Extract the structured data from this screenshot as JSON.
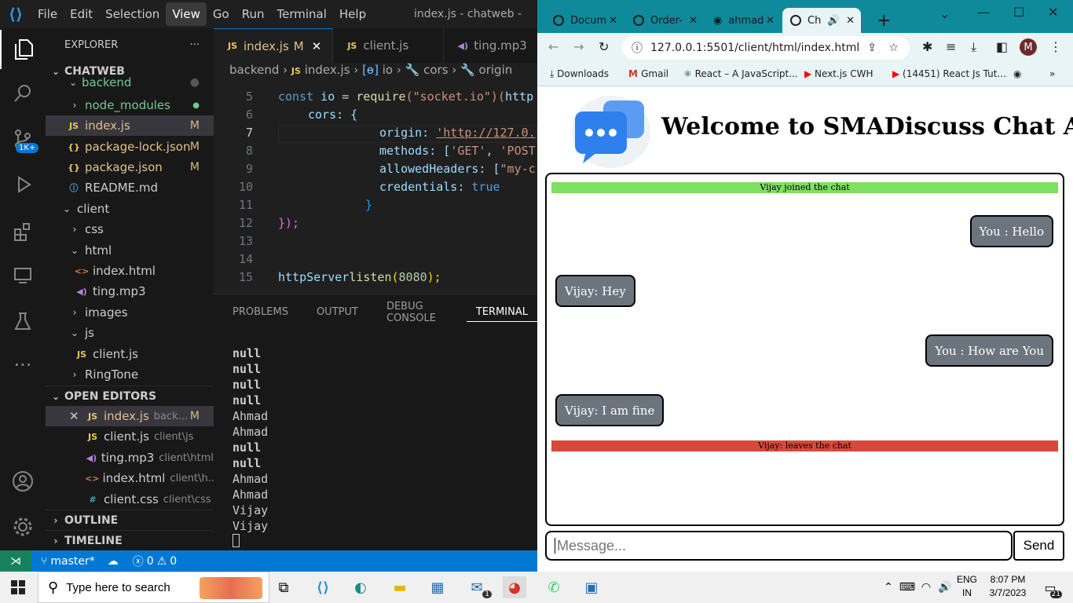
{
  "vscode": {
    "menu": [
      "File",
      "Edit",
      "Selection",
      "View",
      "Go",
      "Run",
      "Terminal",
      "Help"
    ],
    "window_title": "index.js - chatweb -",
    "activity_badge": "1K+",
    "explorer": {
      "header": "EXPLORER",
      "more": "···",
      "root": "CHATWEB",
      "items": [
        {
          "label": "backend",
          "icon": "chevron-down"
        },
        {
          "label": "node_modules",
          "icon": "chevron-right"
        },
        {
          "label": "index.js",
          "icon": "js",
          "mod": "M"
        },
        {
          "label": "package-lock.json",
          "icon": "json",
          "mod": "M"
        },
        {
          "label": "package.json",
          "icon": "json",
          "mod": "M"
        },
        {
          "label": "README.md",
          "icon": "info"
        },
        {
          "label": "client",
          "icon": "chevron-down"
        },
        {
          "label": "css",
          "icon": "chevron-right"
        },
        {
          "label": "html",
          "icon": "chevron-down"
        },
        {
          "label": "index.html",
          "icon": "html"
        },
        {
          "label": "ting.mp3",
          "icon": "audio"
        },
        {
          "label": "images",
          "icon": "chevron-right"
        },
        {
          "label": "js",
          "icon": "chevron-down"
        },
        {
          "label": "client.js",
          "icon": "js"
        },
        {
          "label": "RingTone",
          "icon": "chevron-right"
        }
      ],
      "open_editors_header": "OPEN EDITORS",
      "open_editors": [
        {
          "label": "index.js",
          "path": "back...",
          "mod": "M"
        },
        {
          "label": "client.js",
          "path": "client\\js"
        },
        {
          "label": "ting.mp3",
          "path": "client\\html"
        },
        {
          "label": "index.html",
          "path": "client\\h..."
        },
        {
          "label": "client.css",
          "path": "client\\css"
        }
      ],
      "outline": "OUTLINE",
      "timeline": "TIMELINE"
    },
    "tabs": [
      {
        "label": "index.js",
        "mod": "M",
        "active": true
      },
      {
        "label": "client.js"
      },
      {
        "label": "ting.mp3"
      }
    ],
    "breadcrumb": [
      "backend",
      "index.js",
      "io",
      "cors",
      "origin"
    ],
    "code_lines": [
      "5",
      "6",
      "7",
      "8",
      "9",
      "10",
      "11",
      "12",
      "13",
      "14",
      "15"
    ],
    "code": {
      "l5_a": "const",
      "l5_b": " io ",
      "l5_c": "= ",
      "l5_d": "require",
      "l5_e": "(\"socket.io\")(",
      "l5_f": "http",
      "l6": "cors: {",
      "l7_a": "origin: ",
      "l7_b": "'http://127.0.",
      "l8_a": "methods: [",
      "l8_b": "'GET'",
      ", ": ", ",
      "l8_c": "'POST",
      "l9_a": "allowedHeaders: [",
      "l9_b": "\"my-c",
      "l10_a": "credentials: ",
      "l10_b": "true",
      "l11": "}",
      "l12": "});",
      "l15_a": "httpServer",
      ".": ".",
      "l15_b": "listen",
      "l15_c": "(",
      "l15_d": "8080",
      "l15_e": ");"
    },
    "panel_tabs": [
      "PROBLEMS",
      "OUTPUT",
      "DEBUG CONSOLE",
      "TERMINAL"
    ],
    "terminal_lines": [
      "null",
      "null",
      "null",
      "null",
      "Ahmad",
      "Ahmad",
      "null",
      "null",
      "Ahmad",
      "Ahmad",
      "Vijay",
      "Vijay"
    ],
    "status": {
      "branch": "master*",
      "errors": "0",
      "warnings": "0"
    }
  },
  "browser": {
    "tabs": [
      "Docum",
      "Order-",
      "ahmad",
      "Ch"
    ],
    "new_tab": "+",
    "url": "127.0.0.1:5501/client/html/index.html",
    "profile": "M",
    "bookmarks": [
      "Downloads",
      "Gmail",
      "React – A JavaScript...",
      "Next.js CWH",
      "(14451) React Js Tut..."
    ],
    "page": {
      "title": "Welcome to SMADiscuss Chat App",
      "joined": "Vijay joined the chat",
      "messages": [
        {
          "text": "You : Hello",
          "side": "right"
        },
        {
          "text": "Vijay: Hey",
          "side": "left"
        },
        {
          "text": "You : How are You",
          "side": "right"
        },
        {
          "text": "Vijay: I am fine",
          "side": "left"
        }
      ],
      "left": "Vijay: leaves the chat",
      "input_placeholder": "Message...",
      "send_label": "Send",
      "joined_color": "#7ee062",
      "left_color": "#d9493b"
    }
  },
  "taskbar": {
    "search_placeholder": "Type here to search",
    "lang_1": "ENG",
    "lang_2": "IN",
    "time": "8:07 PM",
    "date": "3/7/2023",
    "notif_count": "21",
    "mail_badge": "1"
  }
}
